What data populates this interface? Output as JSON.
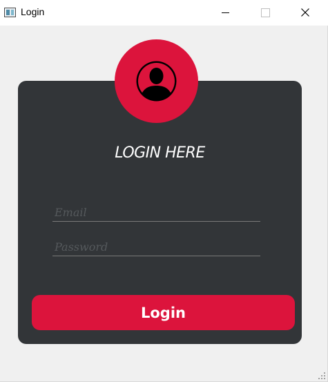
{
  "window": {
    "title": "Login"
  },
  "form": {
    "heading": "LOGIN HERE",
    "email": {
      "value": "",
      "placeholder": "Email"
    },
    "password": {
      "value": "",
      "placeholder": "Password"
    },
    "login_label": "Login"
  },
  "colors": {
    "accent": "#dc143c",
    "card": "#323538",
    "background": "#f0f0f0"
  },
  "icons": {
    "app": "app-window-icon",
    "avatar": "user-avatar-icon",
    "minimize": "minimize-icon",
    "maximize": "maximize-icon",
    "close": "close-icon"
  }
}
